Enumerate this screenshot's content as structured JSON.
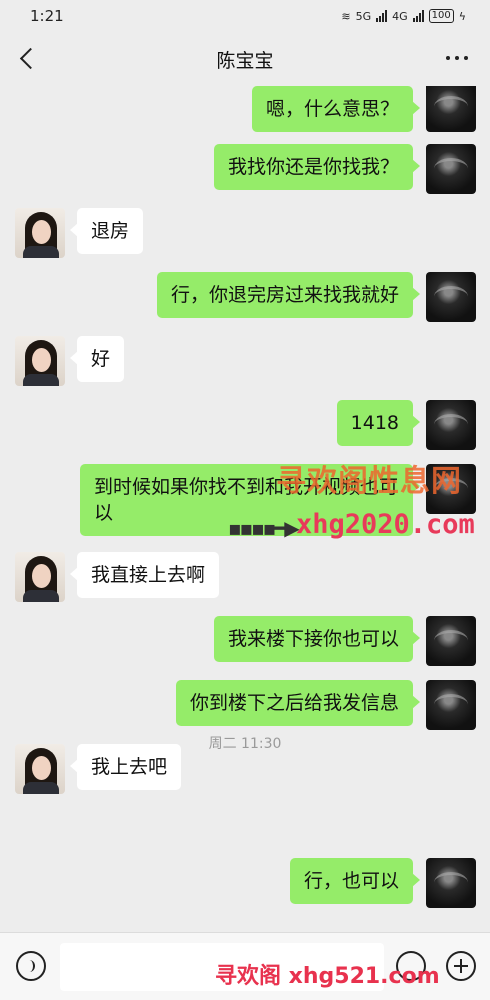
{
  "status": {
    "time": "1:21",
    "network_1": "5G",
    "network_2": "4G",
    "battery": "100"
  },
  "header": {
    "title": "陈宝宝"
  },
  "messages": [
    {
      "from": "me",
      "text": "嗯，什么意思？"
    },
    {
      "from": "me",
      "text": "我找你还是你找我？"
    },
    {
      "from": "her",
      "text": "退房"
    },
    {
      "from": "me",
      "text": "行，你退完房过来找我就好"
    },
    {
      "from": "her",
      "text": "好"
    },
    {
      "from": "me",
      "text": "1418"
    },
    {
      "from": "me",
      "text": "到时候如果你找不到和我开视频也可以"
    },
    {
      "from": "her",
      "text": "我直接上去啊"
    },
    {
      "from": "me",
      "text": "我来楼下接你也可以"
    },
    {
      "from": "me",
      "text": "你到楼下之后给我发信息"
    },
    {
      "from": "her",
      "text": "我上去吧"
    },
    {
      "from": "me",
      "text": "行，也可以"
    }
  ],
  "time_stamp": "周二 11:30",
  "watermarks": {
    "top": "寻欢阁性息网",
    "middle": "xhg2020.com",
    "bottom": "寻欢阁 xhg521.com"
  },
  "input": {
    "value": ""
  },
  "icons": [
    "back-icon",
    "more-icon",
    "voice-icon",
    "emoji-icon",
    "plus-icon"
  ],
  "colors": {
    "my_bubble": "#95ec69",
    "her_bubble": "#ffffff",
    "background": "#ededed"
  }
}
